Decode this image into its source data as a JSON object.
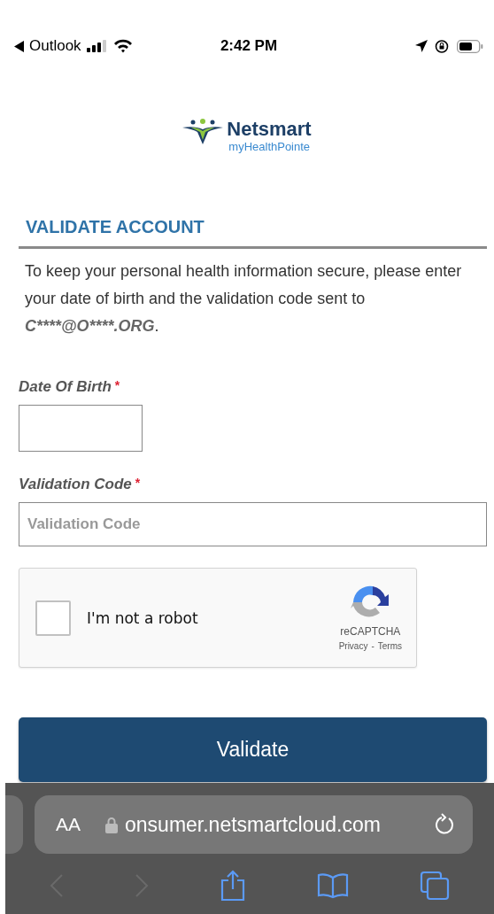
{
  "status_bar": {
    "back_app": "Outlook",
    "time": "2:42 PM"
  },
  "logo": {
    "name": "Netsmart",
    "subtitle": "myHealthPointe"
  },
  "heading": "VALIDATE ACCOUNT",
  "message": {
    "text": "To keep your personal health information secure, please enter your date of birth and the validation code sent to ",
    "email": "C****@O****.ORG",
    "end": "."
  },
  "fields": [
    {
      "kind": "date",
      "label": "Date Of Birth",
      "required_mark": "*"
    },
    {
      "kind": "text",
      "label": "Validation Code",
      "required_mark": "*",
      "placeholder": "Validation Code"
    }
  ],
  "captcha": {
    "label": "I'm not a robot",
    "checked": false,
    "brand": "reCAPTCHA",
    "privacy": "Privacy",
    "separator": "-",
    "terms": "Terms"
  },
  "submit_button": "Validate",
  "browser": {
    "text_size": "AA",
    "url": "onsumer.netsmartcloud.com",
    "back_disabled": true,
    "forward_disabled": true
  }
}
